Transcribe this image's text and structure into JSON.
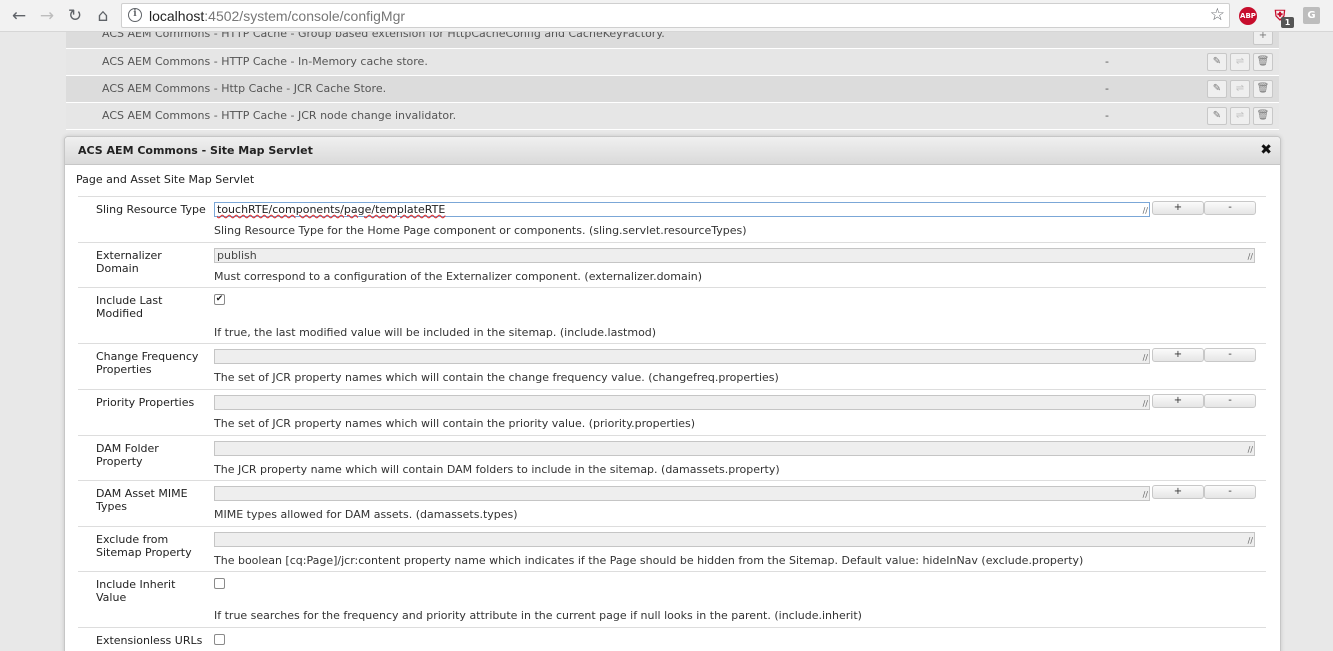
{
  "browser": {
    "url_host": "localhost",
    "url_path": ":4502/system/console/configMgr",
    "ext_abp": "ABP",
    "ext_badge": "1",
    "ext_g": "G"
  },
  "config_list": [
    {
      "name": "ACS AEM Commons - HTTP Cache - Group based extension for HttpCacheConfig and CacheKeyFactory.",
      "bundle": ""
    },
    {
      "name": "ACS AEM Commons - HTTP Cache - In-Memory cache store.",
      "bundle": "-"
    },
    {
      "name": "ACS AEM Commons - Http Cache - JCR Cache Store.",
      "bundle": "-"
    },
    {
      "name": "ACS AEM Commons - HTTP Cache - JCR node change invalidator.",
      "bundle": "-"
    }
  ],
  "dialog": {
    "title": "ACS AEM Commons - Site Map Servlet",
    "description": "Page and Asset Site Map Servlet",
    "plus": "+",
    "minus": "-",
    "props": [
      {
        "label": "Sling Resource Type",
        "value": "touchRTE/components/page/templateRTE",
        "hint": "Sling Resource Type for the Home Page component or components. (sling.servlet.resourceTypes)"
      },
      {
        "label": "Externalizer Domain",
        "value": "publish",
        "hint": "Must correspond to a configuration of the Externalizer component. (externalizer.domain)"
      },
      {
        "label": "Include Last Modified",
        "checked": true,
        "hint": "If true, the last modified value will be included in the sitemap. (include.lastmod)"
      },
      {
        "label": "Change Frequency Properties",
        "value": "",
        "hint": "The set of JCR property names which will contain the change frequency value. (changefreq.properties)"
      },
      {
        "label": "Priority Properties",
        "value": "",
        "hint": "The set of JCR property names which will contain the priority value. (priority.properties)"
      },
      {
        "label": "DAM Folder Property",
        "value": "",
        "hint": "The JCR property name which will contain DAM folders to include in the sitemap. (damassets.property)"
      },
      {
        "label": "DAM Asset MIME Types",
        "value": "",
        "hint": "MIME types allowed for DAM assets. (damassets.types)"
      },
      {
        "label": "Exclude from Sitemap Property",
        "value": "",
        "hint": "The boolean [cq:Page]/jcr:content property name which indicates if the Page should be hidden from the Sitemap. Default value: hideInNav (exclude.property)"
      },
      {
        "label": "Include Inherit Value",
        "checked": false,
        "hint": "If true searches for the frequency and priority attribute in the current page if null looks in the parent. (include.inherit)"
      },
      {
        "label": "Extensionless URLs",
        "checked": false,
        "hint": ""
      }
    ]
  }
}
